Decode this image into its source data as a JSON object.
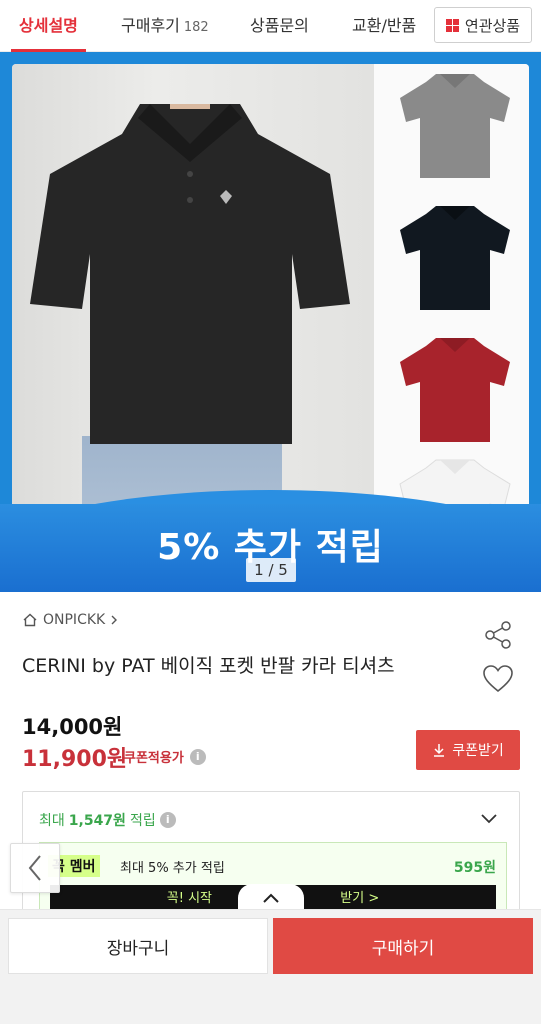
{
  "tabs": [
    {
      "label": "상세설명",
      "count": ""
    },
    {
      "label": "구매후기",
      "count": "182"
    },
    {
      "label": "상품문의",
      "count": ""
    },
    {
      "label": "교환/반품",
      "count": ""
    }
  ],
  "related_button": "연관상품",
  "hero": {
    "banner_text": "5% 추가 적립",
    "page_indicator": "1 / 5",
    "shirt_colors": [
      "#2b2b2b",
      "#8a8a8a",
      "#111820",
      "#a8232c",
      "#f4f4f4"
    ]
  },
  "product": {
    "brand": "ONPICKK",
    "title": "CERINI by PAT 베이직 포켓 반팔 카라 티셔츠",
    "price_original": "14,000원",
    "price_sale": "11,900원",
    "coupon_note": "쿠폰적용가",
    "coupon_button": "쿠폰받기"
  },
  "points": {
    "prefix": "최대",
    "amount": "1,547원",
    "suffix": "적립",
    "member_badge": "꼭 멤버",
    "member_desc": "최대 5% 추가 적립",
    "member_amount": "595원",
    "member_bar_left": "꼭! 시작",
    "member_bar_right": "받기 >"
  },
  "bottom": {
    "cart_label": "장바구니",
    "buy_label": "구매하기"
  },
  "colors": {
    "accent_red": "#e4303a",
    "button_red": "#e04a44",
    "point_green": "#3aa64c",
    "banner_blue": "#1e88d8"
  }
}
